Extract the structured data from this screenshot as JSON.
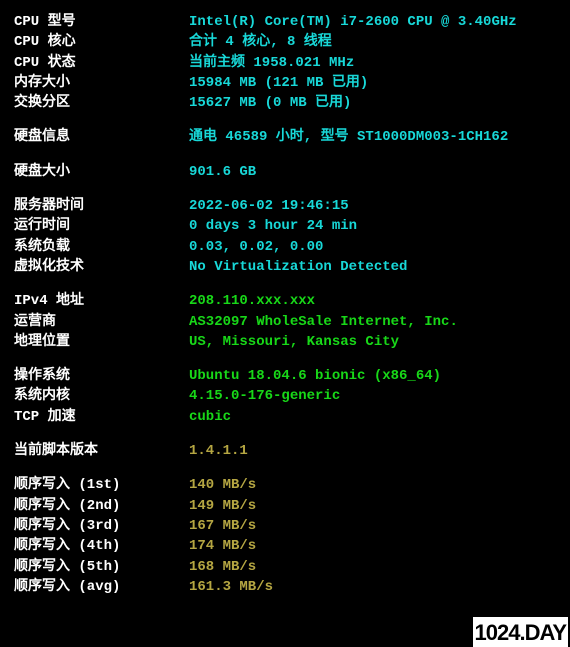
{
  "sys": {
    "cpu_model_label": "CPU 型号",
    "cpu_model_value": "Intel(R) Core(TM) i7-2600 CPU @ 3.40GHz",
    "cpu_cores_label": "CPU 核心",
    "cpu_cores_value": "合计 4 核心, 8 线程",
    "cpu_status_label": "CPU 状态",
    "cpu_status_value": "当前主频 1958.021 MHz",
    "mem_label": "内存大小",
    "mem_value": "15984 MB (121 MB 已用)",
    "swap_label": "交换分区",
    "swap_value": "15627 MB (0 MB 已用)",
    "disk_info_label": "硬盘信息",
    "disk_info_value": "通电 46589 小时, 型号 ST1000DM003-1CH162",
    "disk_size_label": "硬盘大小",
    "disk_size_value": "901.6 GB",
    "server_time_label": "服务器时间",
    "server_time_value": "2022-06-02 19:46:15",
    "uptime_label": "运行时间",
    "uptime_value": "0 days 3 hour 24 min",
    "load_label": "系统负载",
    "load_value": "0.03, 0.02, 0.00",
    "virt_label": "虚拟化技术",
    "virt_value": "No Virtualization Detected",
    "ipv4_label": "IPv4 地址",
    "ipv4_value": "208.110.xxx.xxx",
    "isp_label": "运营商",
    "isp_value": "AS32097 WholeSale Internet, Inc.",
    "geo_label": "地理位置",
    "geo_value": "US, Missouri, Kansas City",
    "os_label": "操作系统",
    "os_value": "Ubuntu 18.04.6 bionic (x86_64)",
    "kernel_label": "系统内核",
    "kernel_value": "4.15.0-176-generic",
    "tcp_label": "TCP 加速",
    "tcp_value": "cubic",
    "script_ver_label": "当前脚本版本",
    "script_ver_value": "1.4.1.1"
  },
  "seq": {
    "w1_label": "顺序写入 (1st)",
    "w1_value": "140 MB/s",
    "w2_label": "顺序写入 (2nd)",
    "w2_value": "149 MB/s",
    "w3_label": "顺序写入 (3rd)",
    "w3_value": "167 MB/s",
    "w4_label": "顺序写入 (4th)",
    "w4_value": "174 MB/s",
    "w5_label": "顺序写入 (5th)",
    "w5_value": "168 MB/s",
    "wavg_label": "顺序写入 (avg)",
    "wavg_value": "161.3 MB/s"
  },
  "watermark": "1024.DAY"
}
